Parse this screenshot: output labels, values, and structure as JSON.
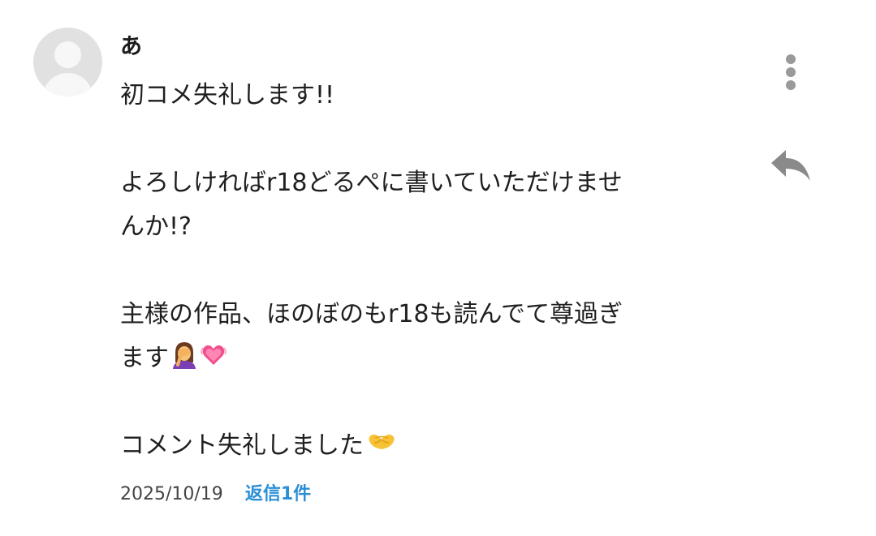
{
  "comment": {
    "author": "あ",
    "paragraphs": {
      "p1_line1": "初コメ失礼します!!",
      "p2_line1": "よろしければr18どるぺに書いていただけませ",
      "p2_line2": "んか!?",
      "p3_line1": "主様の作品、ほのぼのもr18も読んでて尊過ぎ",
      "p3_line2": "ます",
      "p4_line1": "コメント失礼しました"
    },
    "emojis": [
      "woman-facepalming-emoji",
      "beating-heart-emoji",
      "heart-hands-emoji"
    ],
    "date": "2025/10/19",
    "reply_count_label": "返信1件"
  },
  "icons": {
    "more": "more-vertical-icon",
    "reply": "reply-arrow-icon",
    "avatar": "default-avatar-icon"
  },
  "colors": {
    "link": "#2b8fd6",
    "icon_gray": "#9a9a9a",
    "avatar_bg": "#e1e1e1"
  }
}
